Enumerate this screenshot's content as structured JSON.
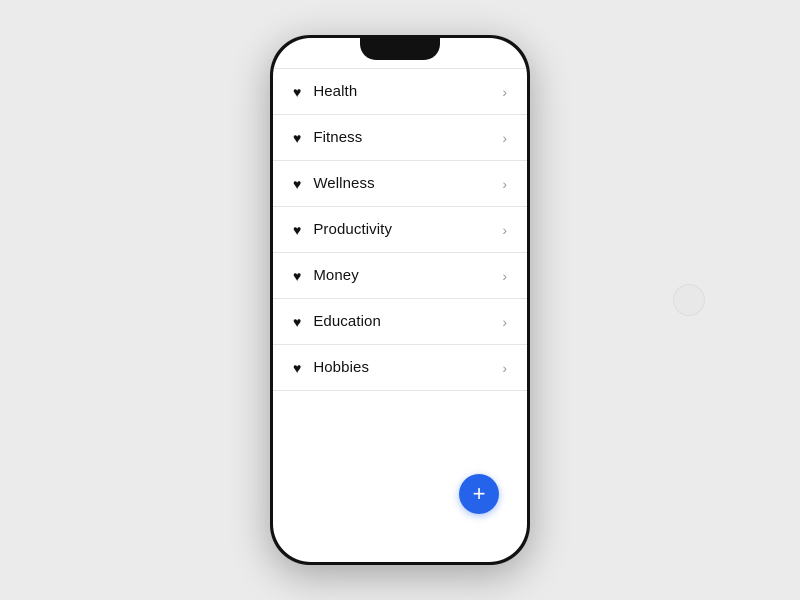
{
  "page": {
    "background_color": "#ebebeb"
  },
  "list": {
    "items": [
      {
        "id": "health",
        "label": "Health"
      },
      {
        "id": "fitness",
        "label": "Fitness"
      },
      {
        "id": "wellness",
        "label": "Wellness"
      },
      {
        "id": "productivity",
        "label": "Productivity"
      },
      {
        "id": "money",
        "label": "Money"
      },
      {
        "id": "education",
        "label": "Education"
      },
      {
        "id": "hobbies",
        "label": "Hobbies"
      }
    ]
  },
  "fab": {
    "label": "+"
  },
  "icons": {
    "heart": "♥",
    "chevron": "›"
  }
}
